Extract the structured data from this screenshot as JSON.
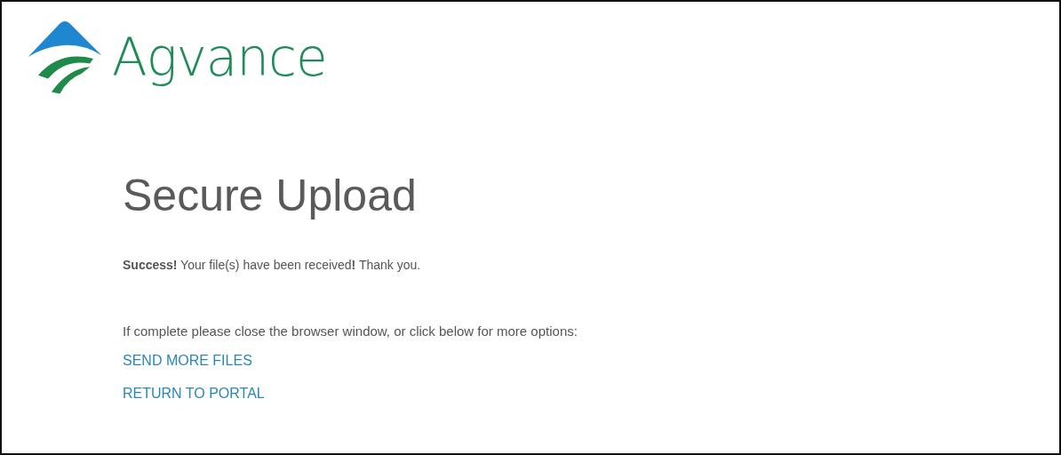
{
  "logo": {
    "text": "Agvance"
  },
  "heading": "Secure Upload",
  "message": "**Success!** Your file(s) have been received**!** Thank you.",
  "instructions": "If complete please close the browser window, or click below for more options:",
  "links": [
    "SEND MORE FILES",
    "RETURN TO PORTAL"
  ]
}
